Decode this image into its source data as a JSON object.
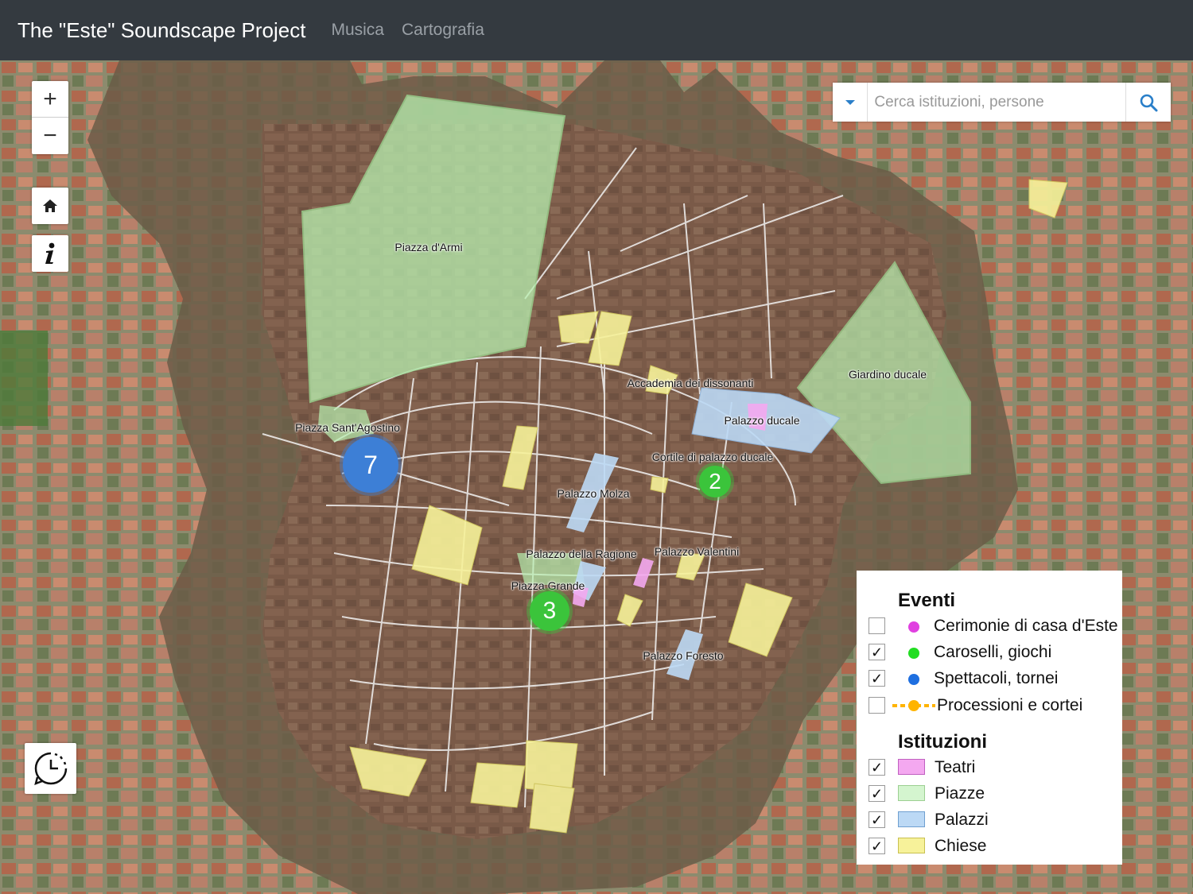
{
  "app_title": "The \"Este\" Soundscape Project",
  "nav": {
    "music": "Musica",
    "maps": "Cartografia"
  },
  "controls": {
    "zoom_in": "+",
    "zoom_out": "−"
  },
  "search": {
    "placeholder": "Cerca istituzioni, persone"
  },
  "map_labels": {
    "piazza_armi": "Piazza d'Armi",
    "giardino": "Giardino ducale",
    "accademia": "Accademia dei dissonanti",
    "palazzo_ducale": "Palazzo ducale",
    "piazza_agostino": "Piazza Sant'Agostino",
    "cortile": "Cortile di palazzo ducale",
    "molza": "Palazzo Molza",
    "ragione": "Palazzo della Ragione",
    "valentini": "Palazzo Valentini",
    "piazza_grande": "Piazza Grande",
    "foresto": "Palazzo Foresto"
  },
  "clusters": [
    {
      "count": "7",
      "category": "Spettacoli, tornei",
      "color": "#3d7fd6"
    },
    {
      "count": "2",
      "category": "Caroselli, giochi",
      "color": "#3bc43b"
    },
    {
      "count": "3",
      "category": "Caroselli, giochi",
      "color": "#3bc43b"
    }
  ],
  "legend": {
    "events_title": "Eventi",
    "events": [
      {
        "label": "Cerimonie di casa d'Este",
        "checked": false,
        "color": "#e040e0"
      },
      {
        "label": "Caroselli, giochi",
        "checked": true,
        "color": "#22dd22"
      },
      {
        "label": "Spettacoli, tornei",
        "checked": true,
        "color": "#1e6fe0"
      },
      {
        "label": "Processioni e cortei",
        "checked": false,
        "color": "#ffb400"
      }
    ],
    "institutions_title": "Istituzioni",
    "institutions": [
      {
        "label": "Teatri",
        "checked": true,
        "color": "#f4a8f0"
      },
      {
        "label": "Piazze",
        "checked": true,
        "color": "#d4f5cf"
      },
      {
        "label": "Palazzi",
        "checked": true,
        "color": "#bcd9f5"
      },
      {
        "label": "Chiese",
        "checked": true,
        "color": "#f7f29a"
      }
    ]
  },
  "checkmark": "✓"
}
